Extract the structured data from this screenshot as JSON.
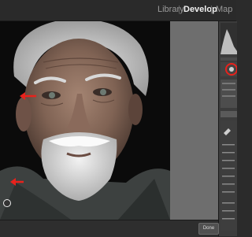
{
  "modules": {
    "library": "Library",
    "develop": "Develop",
    "map": "Map"
  },
  "toolbar": {
    "done_label": "Done"
  },
  "colors": {
    "accent_red": "#e8221c",
    "active_module": "#f0f0f0"
  },
  "icons": [
    "red-arrow-icon",
    "mask-pin-icon",
    "red-circle-highlight-icon",
    "histogram-icon",
    "eyedropper-icon"
  ]
}
